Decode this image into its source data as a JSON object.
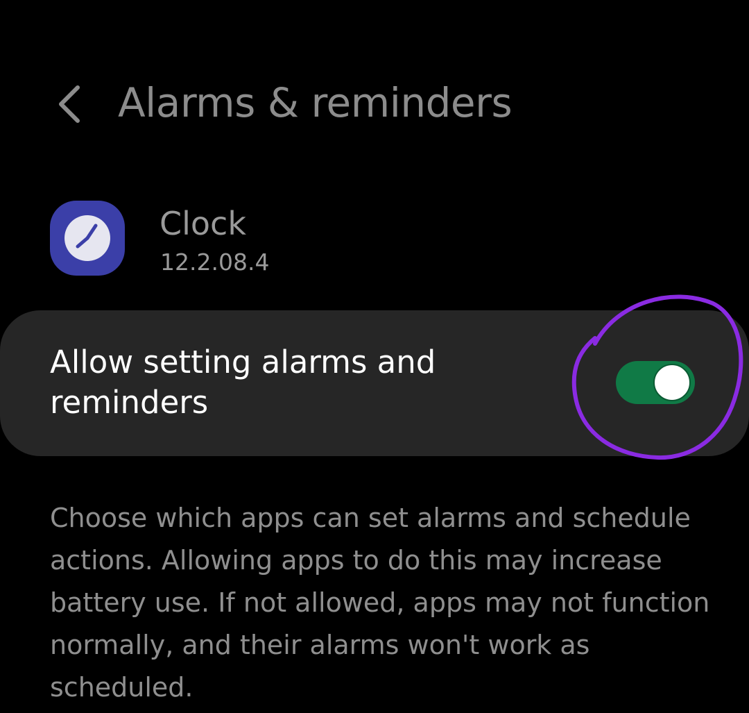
{
  "header": {
    "back_icon": "chevron-left-icon",
    "title": "Alarms & reminders"
  },
  "app": {
    "icon": "clock-icon",
    "name": "Clock",
    "version": "12.2.08.4"
  },
  "setting": {
    "label": "Allow setting alarms and reminders",
    "toggle_on": true
  },
  "description": "Choose which apps can set alarms and schedule actions. Allowing apps to do this may increase battery use. If not allowed, apps may not function normally, and their alarms won't work as scheduled.",
  "colors": {
    "background": "#000000",
    "card": "#262626",
    "toggle_on": "#107a46",
    "app_icon": "#3b3fa8",
    "annotation": "#8a2be2"
  }
}
